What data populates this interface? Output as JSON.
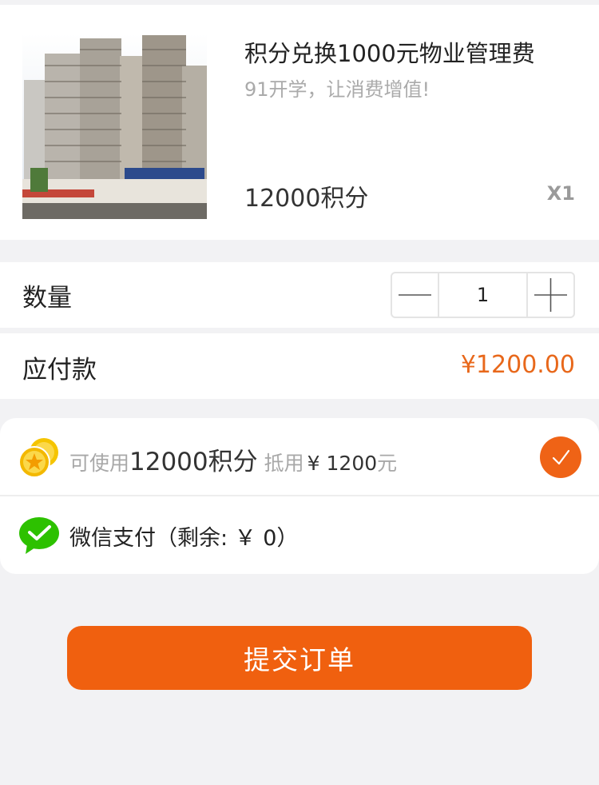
{
  "product": {
    "title": "积分兑换1000元物业管理费",
    "subtitle": "91开学，让消费增值!",
    "points_price": "12000积分",
    "quantity_badge": "X1"
  },
  "order": {
    "quantity_label": "数量",
    "quantity_value": "1",
    "amount_label": "应付款",
    "amount_value": "¥1200.00"
  },
  "payment": {
    "points_prefix": "可使用",
    "points_value": "12000积分",
    "deduct_label": "抵用",
    "deduct_amount": "¥ 1200",
    "deduct_unit": "元",
    "points_checked": true,
    "wechat_label": "微信支付（剩余: ￥  0）"
  },
  "submit_label": "提交订单",
  "colors": {
    "accent": "#f0600f",
    "price": "#e8681b",
    "wechat": "#2dc100",
    "coin": "#f5c400"
  },
  "icons": {
    "points": "gold-coins-icon",
    "wechat": "wechat-pay-icon",
    "checked": "checkmark-circle-icon"
  }
}
